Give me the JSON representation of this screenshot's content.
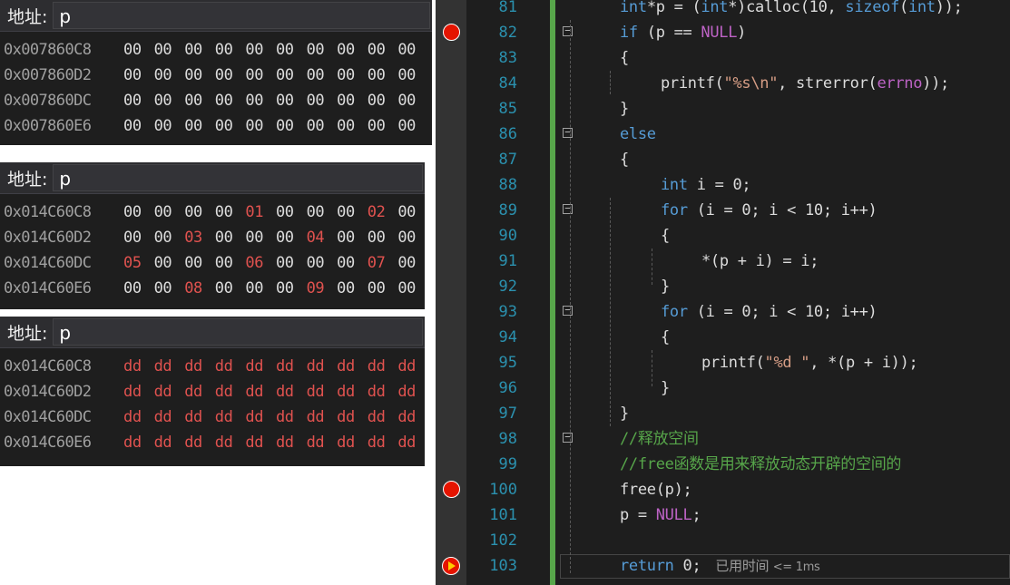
{
  "memory_panels": [
    {
      "label": "地址:",
      "address_input": "p",
      "rows": [
        {
          "addr": "0x007860C8",
          "bytes": [
            "00",
            "00",
            "00",
            "00",
            "00",
            "00",
            "00",
            "00",
            "00",
            "00"
          ],
          "changed": []
        },
        {
          "addr": "0x007860D2",
          "bytes": [
            "00",
            "00",
            "00",
            "00",
            "00",
            "00",
            "00",
            "00",
            "00",
            "00"
          ],
          "changed": []
        },
        {
          "addr": "0x007860DC",
          "bytes": [
            "00",
            "00",
            "00",
            "00",
            "00",
            "00",
            "00",
            "00",
            "00",
            "00"
          ],
          "changed": []
        },
        {
          "addr": "0x007860E6",
          "bytes": [
            "00",
            "00",
            "00",
            "00",
            "00",
            "00",
            "00",
            "00",
            "00",
            "00"
          ],
          "changed": []
        }
      ]
    },
    {
      "label": "地址:",
      "address_input": "p",
      "rows": [
        {
          "addr": "0x014C60C8",
          "bytes": [
            "00",
            "00",
            "00",
            "00",
            "01",
            "00",
            "00",
            "00",
            "02",
            "00"
          ],
          "changed": [
            4,
            8
          ]
        },
        {
          "addr": "0x014C60D2",
          "bytes": [
            "00",
            "00",
            "03",
            "00",
            "00",
            "00",
            "04",
            "00",
            "00",
            "00"
          ],
          "changed": [
            2,
            6
          ]
        },
        {
          "addr": "0x014C60DC",
          "bytes": [
            "05",
            "00",
            "00",
            "00",
            "06",
            "00",
            "00",
            "00",
            "07",
            "00"
          ],
          "changed": [
            0,
            4,
            8
          ]
        },
        {
          "addr": "0x014C60E6",
          "bytes": [
            "00",
            "00",
            "08",
            "00",
            "00",
            "00",
            "09",
            "00",
            "00",
            "00"
          ],
          "changed": [
            2,
            6
          ]
        }
      ]
    },
    {
      "label": "地址:",
      "address_input": "p",
      "rows": [
        {
          "addr": "0x014C60C8",
          "bytes": [
            "dd",
            "dd",
            "dd",
            "dd",
            "dd",
            "dd",
            "dd",
            "dd",
            "dd",
            "dd"
          ],
          "changed": [
            0,
            1,
            2,
            3,
            4,
            5,
            6,
            7,
            8,
            9
          ]
        },
        {
          "addr": "0x014C60D2",
          "bytes": [
            "dd",
            "dd",
            "dd",
            "dd",
            "dd",
            "dd",
            "dd",
            "dd",
            "dd",
            "dd"
          ],
          "changed": [
            0,
            1,
            2,
            3,
            4,
            5,
            6,
            7,
            8,
            9
          ]
        },
        {
          "addr": "0x014C60DC",
          "bytes": [
            "dd",
            "dd",
            "dd",
            "dd",
            "dd",
            "dd",
            "dd",
            "dd",
            "dd",
            "dd"
          ],
          "changed": [
            0,
            1,
            2,
            3,
            4,
            5,
            6,
            7,
            8,
            9
          ]
        },
        {
          "addr": "0x014C60E6",
          "bytes": [
            "dd",
            "dd",
            "dd",
            "dd",
            "dd",
            "dd",
            "dd",
            "dd",
            "dd",
            "dd"
          ],
          "changed": [
            0,
            1,
            2,
            3,
            4,
            5,
            6,
            7,
            8,
            9
          ]
        }
      ]
    }
  ],
  "editor": {
    "lines": [
      {
        "n": "81",
        "html": "<span class=\"kw\">int</span>*p = (<span class=\"kw\">int</span>*)calloc(10, <span class=\"kw\">sizeof</span>(<span class=\"kw\">int</span>));",
        "indent": 0
      },
      {
        "n": "82",
        "html": "<span class=\"kw\">if</span> (p == <span class=\"mac\">NULL</span>)",
        "indent": 0,
        "breakpoint": true,
        "fold": true
      },
      {
        "n": "83",
        "html": "{",
        "indent": 0
      },
      {
        "n": "84",
        "html": "printf(<span class=\"str\">\"%s\\n\"</span>, strerror(<span class=\"mac\">errno</span>));",
        "indent": 1
      },
      {
        "n": "85",
        "html": "}",
        "indent": 0
      },
      {
        "n": "86",
        "html": "<span class=\"kw\">else</span>",
        "indent": 0,
        "fold": true
      },
      {
        "n": "87",
        "html": "{",
        "indent": 0
      },
      {
        "n": "88",
        "html": "<span class=\"kw\">int</span> i = 0;",
        "indent": 1
      },
      {
        "n": "89",
        "html": "<span class=\"kw\">for</span> (i = 0; i &lt; 10; i++)",
        "indent": 1,
        "fold": true
      },
      {
        "n": "90",
        "html": "{",
        "indent": 1
      },
      {
        "n": "91",
        "html": "*(p + i) = i;",
        "indent": 2
      },
      {
        "n": "92",
        "html": "}",
        "indent": 1
      },
      {
        "n": "93",
        "html": "<span class=\"kw\">for</span> (i = 0; i &lt; 10; i++)",
        "indent": 1,
        "fold": true
      },
      {
        "n": "94",
        "html": "{",
        "indent": 1
      },
      {
        "n": "95",
        "html": "printf(<span class=\"str\">\"%d \"</span>, *(p + i));",
        "indent": 2
      },
      {
        "n": "96",
        "html": "}",
        "indent": 1
      },
      {
        "n": "97",
        "html": "}",
        "indent": 0
      },
      {
        "n": "98",
        "html": "<span class=\"cm\">//释放空间</span>",
        "indent": 0,
        "fold": true
      },
      {
        "n": "99",
        "html": "<span class=\"cm\">//free函数是用来释放动态开辟的空间的</span>",
        "indent": 0
      },
      {
        "n": "100",
        "html": "free(p);",
        "indent": 0,
        "breakpoint": true
      },
      {
        "n": "101",
        "html": "p = <span class=\"mac\">NULL</span>;",
        "indent": 0
      },
      {
        "n": "102",
        "html": "",
        "indent": 0
      },
      {
        "n": "103",
        "html": "<span class=\"kw\">return</span> 0;",
        "indent": 0,
        "current": true
      }
    ],
    "perf_tip_text": "已用时间",
    "perf_tip_value": "<= 1ms"
  }
}
